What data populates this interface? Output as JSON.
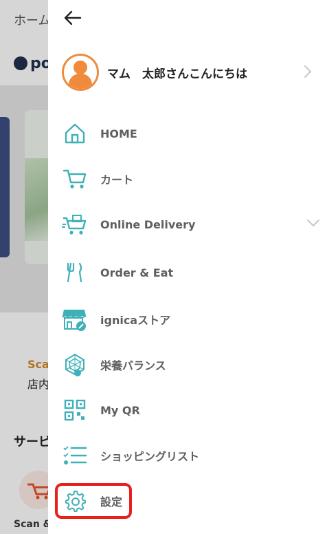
{
  "background_page": {
    "title": "ホーム",
    "logo_text": "po",
    "section_label": "Sca",
    "section_subtitle": "店内",
    "service_heading": "サービ",
    "scan_label": "Scan &"
  },
  "drawer": {
    "profile": {
      "greeting": "マム　太郎さんこんにちは"
    },
    "menu": [
      {
        "label": "HOME",
        "icon": "home-icon"
      },
      {
        "label": "カート",
        "icon": "cart-icon"
      },
      {
        "label": "Online Delivery",
        "icon": "delivery-cart-icon",
        "expandable": true
      },
      {
        "label": "Order & Eat",
        "icon": "fork-knife-icon"
      },
      {
        "label": "ignicaストア",
        "icon": "store-icon"
      },
      {
        "label": "栄養バランス",
        "icon": "nutrition-chart-icon"
      },
      {
        "label": "My QR",
        "icon": "qr-code-icon"
      },
      {
        "label": "ショッピングリスト",
        "icon": "checklist-icon"
      },
      {
        "label": "設定",
        "icon": "gear-icon",
        "highlighted": true
      }
    ]
  },
  "colors": {
    "icon_accent": "#3fb0b8",
    "avatar_orange": "#f08a3c",
    "highlight_red": "#e8201c",
    "label_gray": "#5f5f5f"
  }
}
